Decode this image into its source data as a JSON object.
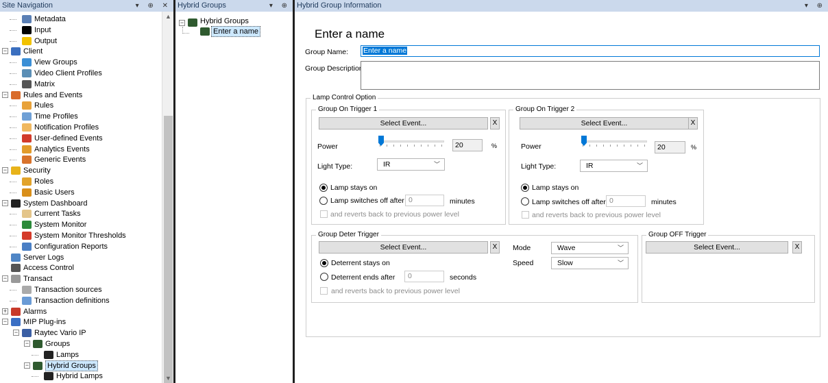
{
  "site_nav": {
    "title": "Site Navigation",
    "toolbar": "▾ ⊕ ✕",
    "items": [
      {
        "label": "Metadata",
        "icon": "metadata-icon",
        "color": "#5a7fb5"
      },
      {
        "label": "Input",
        "icon": "input-icon",
        "color": "#000"
      },
      {
        "label": "Output",
        "icon": "output-bulb-icon",
        "color": "#f2c200"
      },
      {
        "label": "Client",
        "icon": "client-icon",
        "color": "#3b6fbf"
      },
      {
        "label": "View Groups",
        "icon": "view-groups-icon",
        "color": "#3b8fd6"
      },
      {
        "label": "Video Client Profiles",
        "icon": "video-client-profiles-icon",
        "color": "#5b8fb6"
      },
      {
        "label": "Matrix",
        "icon": "matrix-icon",
        "color": "#555"
      },
      {
        "label": "Rules and Events",
        "icon": "rules-events-icon",
        "color": "#d96b2a"
      },
      {
        "label": "Rules",
        "icon": "rules-icon",
        "color": "#e8a23a"
      },
      {
        "label": "Time Profiles",
        "icon": "time-profiles-icon",
        "color": "#6fa0d6"
      },
      {
        "label": "Notification Profiles",
        "icon": "notification-profiles-icon",
        "color": "#f0b860"
      },
      {
        "label": "User-defined Events",
        "icon": "user-defined-events-icon",
        "color": "#d23b2b"
      },
      {
        "label": "Analytics Events",
        "icon": "analytics-events-icon",
        "color": "#e29b2a"
      },
      {
        "label": "Generic Events",
        "icon": "generic-events-icon",
        "color": "#d9732a"
      },
      {
        "label": "Security",
        "icon": "security-icon",
        "color": "#e8b31a"
      },
      {
        "label": "Roles",
        "icon": "roles-icon",
        "color": "#e2a32a"
      },
      {
        "label": "Basic Users",
        "icon": "basic-users-icon",
        "color": "#d98f1a"
      },
      {
        "label": "System Dashboard",
        "icon": "system-dashboard-icon",
        "color": "#222"
      },
      {
        "label": "Current Tasks",
        "icon": "current-tasks-icon",
        "color": "#e4c58a"
      },
      {
        "label": "System Monitor",
        "icon": "system-monitor-icon",
        "color": "#2c8a3a"
      },
      {
        "label": "System Monitor Thresholds",
        "icon": "system-monitor-thresholds-icon",
        "color": "#d43a2a"
      },
      {
        "label": "Configuration Reports",
        "icon": "configuration-reports-icon",
        "color": "#4a7fc5"
      },
      {
        "label": "Server Logs",
        "icon": "server-logs-icon",
        "color": "#4f86c6"
      },
      {
        "label": "Access Control",
        "icon": "access-control-icon",
        "color": "#555"
      },
      {
        "label": "Transact",
        "icon": "transact-icon",
        "color": "#999"
      },
      {
        "label": "Transaction sources",
        "icon": "transaction-sources-icon",
        "color": "#aaa"
      },
      {
        "label": "Transaction definitions",
        "icon": "transaction-definitions-icon",
        "color": "#6a9bd6"
      },
      {
        "label": "Alarms",
        "icon": "alarms-icon",
        "color": "#c83a2a"
      },
      {
        "label": "MIP Plug-ins",
        "icon": "mip-plugins-icon",
        "color": "#3a6fc4"
      },
      {
        "label": "Raytec Vario IP",
        "icon": "raytec-icon",
        "color": "#3a5fa4"
      },
      {
        "label": "Groups",
        "icon": "groups-icon",
        "color": "#2f5a2f"
      },
      {
        "label": "Lamps",
        "icon": "lamps-icon",
        "color": "#222"
      },
      {
        "label": "Hybrid Groups",
        "icon": "hybrid-groups-icon",
        "color": "#2f5a2f"
      },
      {
        "label": "Hybrid Lamps",
        "icon": "hybrid-lamps-icon",
        "color": "#222"
      }
    ]
  },
  "hybrid_groups": {
    "title": "Hybrid Groups",
    "toolbar": "▾ ⊕",
    "root": "Hybrid Groups",
    "child": "Enter a name"
  },
  "info": {
    "title": "Hybrid Group Information",
    "toolbar": "▾ ⊕",
    "heading": "Enter a name",
    "group_name_label": "Group Name:",
    "group_name_value": "Enter a name",
    "group_desc_label": "Group Description:",
    "lamp_control": "Lamp Control Option",
    "trigger1": {
      "title": "Group On Trigger 1",
      "select_event": "Select Event...",
      "x": "X",
      "power_label": "Power",
      "power_value": "20",
      "power_level": 0.2,
      "percent": "%",
      "light_type_label": "Light Type:",
      "light_type_value": "IR",
      "stays_on": "Lamp stays on",
      "switches_off": "Lamp switches off after",
      "minutes_value": "0",
      "minutes": "minutes",
      "reverts": "and reverts back to previous power level"
    },
    "trigger2": {
      "title": "Group On Trigger 2",
      "select_event": "Select Event...",
      "x": "X",
      "power_label": "Power",
      "power_value": "20",
      "power_level": 0.2,
      "percent": "%",
      "light_type_label": "Light Type:",
      "light_type_value": "IR",
      "stays_on": "Lamp stays on",
      "switches_off": "Lamp switches off after",
      "minutes_value": "0",
      "minutes": "minutes",
      "reverts": "and reverts back to previous power level"
    },
    "deter": {
      "title": "Group Deter Trigger",
      "select_event": "Select Event...",
      "x": "X",
      "mode_label": "Mode",
      "mode_value": "Wave",
      "speed_label": "Speed",
      "speed_value": "Slow",
      "stays_on": "Deterrent stays on",
      "ends_after": "Deterrent ends after",
      "seconds_value": "0",
      "seconds": "seconds",
      "reverts": "and reverts back to previous power level"
    },
    "off": {
      "title": "Group OFF Trigger",
      "select_event": "Select Event...",
      "x": "X"
    }
  }
}
